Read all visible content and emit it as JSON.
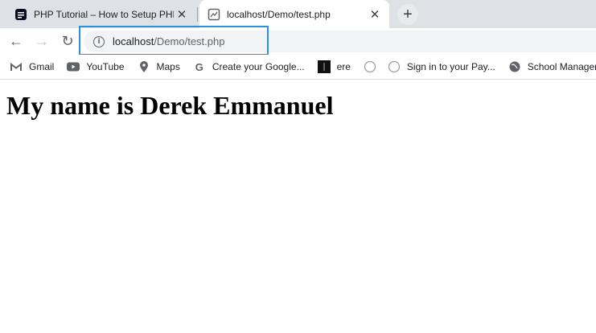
{
  "tabs": [
    {
      "title": "PHP Tutorial – How to Setup PHP",
      "close": "✕"
    },
    {
      "title": "localhost/Demo/test.php",
      "close": "✕"
    }
  ],
  "new_tab_symbol": "+",
  "toolbar": {
    "back_symbol": "←",
    "forward_symbol": "→",
    "reload_symbol": "↻"
  },
  "address_bar": {
    "host": "localhost",
    "path": "/Demo/test.php",
    "info_symbol": "i"
  },
  "bookmarks": [
    {
      "label": "Gmail",
      "icon": "gmail-icon"
    },
    {
      "label": "YouTube",
      "icon": "youtube-icon"
    },
    {
      "label": "Maps",
      "icon": "maps-icon"
    },
    {
      "label": "Create your Google...",
      "icon": "google-icon"
    },
    {
      "label": "ere",
      "icon": "dark-square-icon"
    },
    {
      "label": "",
      "icon": "globe-outline-icon"
    },
    {
      "label": "Sign in to your Pay...",
      "icon": "globe-outline-icon"
    },
    {
      "label": "School Manager",
      "icon": "globe-filled-icon"
    }
  ],
  "page": {
    "heading": "My name is Derek Emmanuel"
  },
  "colors": {
    "tabstrip": "#dee1e6",
    "highlight_border": "#2a92d8",
    "omnibox_bg": "#f1f3f4"
  }
}
